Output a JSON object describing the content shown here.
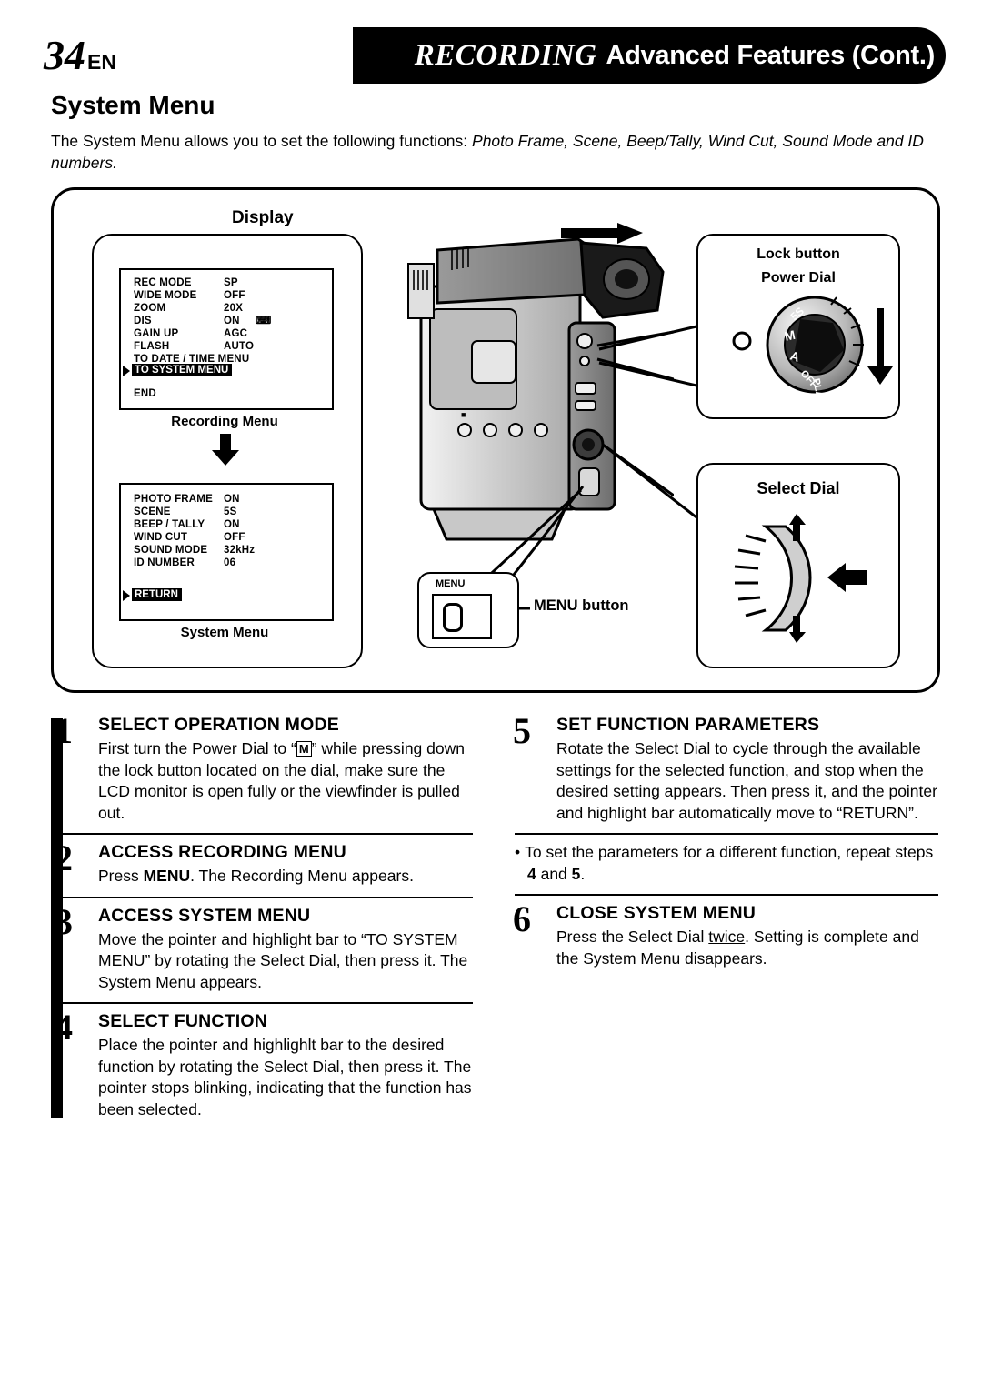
{
  "header": {
    "page_number": "34",
    "page_lang": "EN",
    "title_main": "RECORDING",
    "title_sub": "Advanced Features (Cont.)"
  },
  "section": {
    "title": "System Menu",
    "intro_plain": "The System Menu allows you to set the following functions: ",
    "intro_italic": "Photo Frame, Scene, Beep/Tally, Wind Cut, Sound Mode and ID numbers."
  },
  "illustration": {
    "display_label": "Display",
    "recording_menu_caption": "Recording Menu",
    "system_menu_caption": "System Menu",
    "recording_menu": {
      "rows": [
        {
          "label": "REC MODE",
          "value": "SP"
        },
        {
          "label": "WIDE MODE",
          "value": "OFF"
        },
        {
          "label": "ZOOM",
          "value": "20X"
        },
        {
          "label": "DIS",
          "value": "ON"
        },
        {
          "label": "GAIN UP",
          "value": "AGC"
        },
        {
          "label": "FLASH",
          "value": "AUTO"
        },
        {
          "label": "TO DATE / TIME MENU",
          "value": ""
        }
      ],
      "highlight": "TO SYSTEM MENU",
      "end": "END"
    },
    "system_menu": {
      "rows": [
        {
          "label": "PHOTO FRAME",
          "value": "ON"
        },
        {
          "label": "SCENE",
          "value": "5S"
        },
        {
          "label": "BEEP / TALLY",
          "value": "ON"
        },
        {
          "label": "WIND CUT",
          "value": "OFF"
        },
        {
          "label": "SOUND MODE",
          "value": "32kHz"
        },
        {
          "label": "ID NUMBER",
          "value": "06"
        }
      ],
      "highlight": "RETURN"
    },
    "lock_button_label": "Lock button",
    "power_dial_label": "Power Dial",
    "select_dial_label": "Select Dial",
    "menu_button_label": "MENU button",
    "menu_button_text": "MENU",
    "power_dial_positions": [
      "5S",
      "M",
      "A",
      "OFF",
      "PLAY"
    ]
  },
  "steps_left": [
    {
      "num": "1",
      "title": "SELECT OPERATION MODE",
      "body_pre": "First turn the Power Dial to “",
      "body_icon": "M",
      "body_post": "” while pressing down the lock button located on the dial, make sure the LCD monitor is open fully or the viewfinder is pulled out."
    },
    {
      "num": "2",
      "title": "ACCESS RECORDING MENU",
      "body_pre": "Press ",
      "body_bold": "MENU",
      "body_post": ". The Recording Menu appears."
    },
    {
      "num": "3",
      "title": "ACCESS SYSTEM MENU",
      "body": "Move the pointer and highlight bar to “TO SYSTEM MENU” by rotating the Select Dial, then press it. The System Menu appears."
    },
    {
      "num": "4",
      "title": "SELECT FUNCTION",
      "body": "Place the pointer and highlighlt bar to the desired function by rotating the Select Dial, then press it. The pointer stops blinking, indicating that the function has been selected."
    }
  ],
  "steps_right": [
    {
      "num": "5",
      "title": "SET FUNCTION PARAMETERS",
      "body": "Rotate the Select Dial to cycle through the available settings for the selected function, and stop when the desired setting appears. Then press it, and the pointer and highlight bar automatically move to “RETURN”."
    },
    {
      "num": "6",
      "title": "CLOSE SYSTEM MENU",
      "body_pre": "Press the Select Dial ",
      "body_underline": "twice",
      "body_post": ". Setting is complete and the System Menu disappears."
    }
  ],
  "note": {
    "text_pre": "To set the parameters for a different function, repeat steps ",
    "step_a": "4",
    "text_mid": " and ",
    "step_b": "5",
    "text_post": "."
  }
}
